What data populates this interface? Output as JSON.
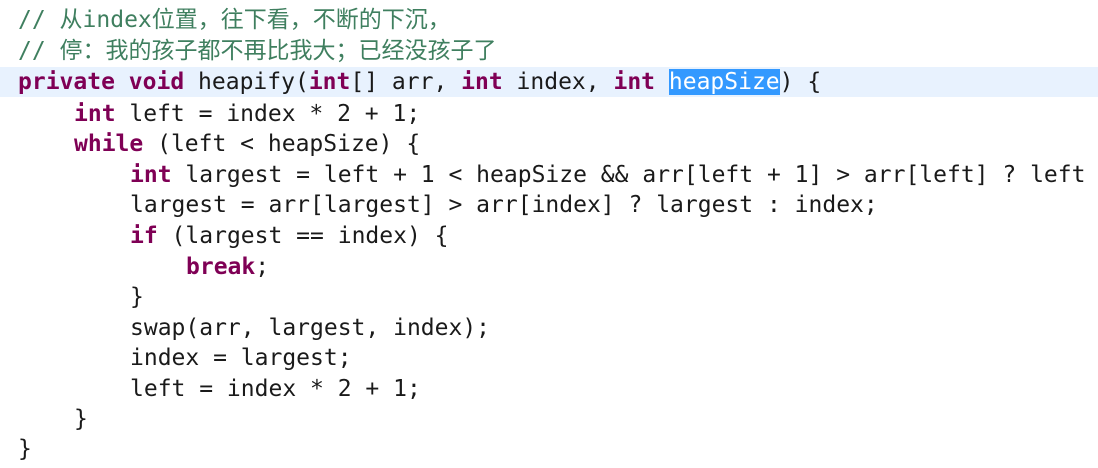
{
  "editor": {
    "colors": {
      "background": "#ffffff",
      "keyword": "#7f0055",
      "comment": "#3f7f5f",
      "text": "#1a1a1a",
      "current_line": "#e8f2fe",
      "selection": "#3399ff"
    },
    "lines": [
      {
        "tokens": [
          {
            "type": "comment",
            "text": "// 从index位置，往下看，不断的下沉，"
          }
        ]
      },
      {
        "tokens": [
          {
            "type": "comment",
            "text": "// 停：我的孩子都不再比我大；已经没孩子了"
          }
        ]
      },
      {
        "tokens": [
          {
            "type": "keyword",
            "text": "private"
          },
          {
            "type": "text",
            "text": " "
          },
          {
            "type": "keyword",
            "text": "void"
          },
          {
            "type": "text",
            "text": " heapify("
          },
          {
            "type": "keyword",
            "text": "int"
          },
          {
            "type": "text",
            "text": "[] arr, "
          },
          {
            "type": "keyword",
            "text": "int"
          },
          {
            "type": "text",
            "text": " index, "
          },
          {
            "type": "keyword",
            "text": "int"
          },
          {
            "type": "text",
            "text": " "
          },
          {
            "type": "selected",
            "text": "heapSize"
          },
          {
            "type": "text",
            "text": ") {"
          }
        ]
      },
      {
        "tokens": [
          {
            "type": "keyword",
            "text": "int"
          },
          {
            "type": "text",
            "text": " left = index * 2 + 1;"
          }
        ]
      },
      {
        "tokens": [
          {
            "type": "keyword",
            "text": "while"
          },
          {
            "type": "text",
            "text": " (left < heapSize) {"
          }
        ]
      },
      {
        "tokens": [
          {
            "type": "keyword",
            "text": "int"
          },
          {
            "type": "text",
            "text": " largest = left + 1 < heapSize && arr[left + 1] > arr[left] ? left"
          }
        ]
      },
      {
        "tokens": [
          {
            "type": "text",
            "text": "largest = arr[largest] > arr[index] ? largest : index;"
          }
        ]
      },
      {
        "tokens": [
          {
            "type": "keyword",
            "text": "if"
          },
          {
            "type": "text",
            "text": " (largest == index) {"
          }
        ]
      },
      {
        "tokens": [
          {
            "type": "keyword",
            "text": "break"
          },
          {
            "type": "text",
            "text": ";"
          }
        ]
      },
      {
        "tokens": [
          {
            "type": "text",
            "text": "}"
          }
        ]
      },
      {
        "tokens": [
          {
            "type": "text",
            "text": "swap(arr, largest, index);"
          }
        ]
      },
      {
        "tokens": [
          {
            "type": "text",
            "text": "index = largest;"
          }
        ]
      },
      {
        "tokens": [
          {
            "type": "text",
            "text": "left = index * 2 + 1;"
          }
        ]
      },
      {
        "tokens": [
          {
            "type": "text",
            "text": "}"
          }
        ]
      },
      {
        "tokens": [
          {
            "type": "text",
            "text": "}"
          }
        ]
      }
    ]
  }
}
